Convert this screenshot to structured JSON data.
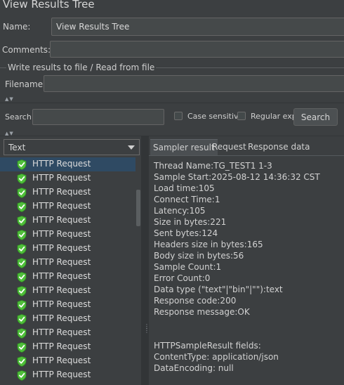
{
  "window": {
    "title": "View Results Tree"
  },
  "form": {
    "name_label": "Name:",
    "name_value": "View Results Tree",
    "comments_label": "Comments:",
    "comments_value": "",
    "file_group_label": "Write results to file / Read from file",
    "filename_label": "Filename",
    "filename_value": ""
  },
  "search": {
    "label": "Search:",
    "value": "",
    "case_sensitive_label": "Case sensitive",
    "case_sensitive_checked": false,
    "regex_label": "Regular exp.",
    "regex_checked": false,
    "button_label": "Search"
  },
  "renderer": {
    "selected": "Text"
  },
  "tree": {
    "items": [
      {
        "label": "HTTP Request",
        "status": "success",
        "selected": true
      },
      {
        "label": "HTTP Request",
        "status": "success"
      },
      {
        "label": "HTTP Request",
        "status": "success"
      },
      {
        "label": "HTTP Request",
        "status": "success"
      },
      {
        "label": "HTTP Request",
        "status": "success"
      },
      {
        "label": "HTTP Request",
        "status": "success"
      },
      {
        "label": "HTTP Request",
        "status": "success"
      },
      {
        "label": "HTTP Request",
        "status": "success"
      },
      {
        "label": "HTTP Request",
        "status": "success"
      },
      {
        "label": "HTTP Request",
        "status": "success"
      },
      {
        "label": "HTTP Request",
        "status": "success"
      },
      {
        "label": "HTTP Request",
        "status": "success"
      },
      {
        "label": "HTTP Request",
        "status": "success"
      },
      {
        "label": "HTTP Request",
        "status": "success"
      },
      {
        "label": "HTTP Request",
        "status": "success"
      },
      {
        "label": "HTTP Request",
        "status": "success"
      }
    ],
    "success_icon": "green-shield-check-icon"
  },
  "tabs": [
    {
      "label": "Sampler result",
      "active": true
    },
    {
      "label": "Request",
      "active": false
    },
    {
      "label": "Response data",
      "active": false
    }
  ],
  "result_lines": [
    "Thread Name:TG_TEST1 1-3",
    "Sample Start:2025-08-12 14:36:32 CST",
    "Load time:105",
    "Connect Time:1",
    "Latency:105",
    "Size in bytes:221",
    "Sent bytes:124",
    "Headers size in bytes:165",
    "Body size in bytes:56",
    "Sample Count:1",
    "Error Count:0",
    "Data type (\"text\"|\"bin\"|\"\"):text",
    "Response code:200",
    "Response message:OK",
    "",
    "",
    "HTTPSampleResult fields:",
    "ContentType: application/json",
    "DataEncoding: null"
  ],
  "colors": {
    "background": "#3c3f41",
    "selection": "#2f4a63",
    "success_green": "#4fbf3a"
  }
}
